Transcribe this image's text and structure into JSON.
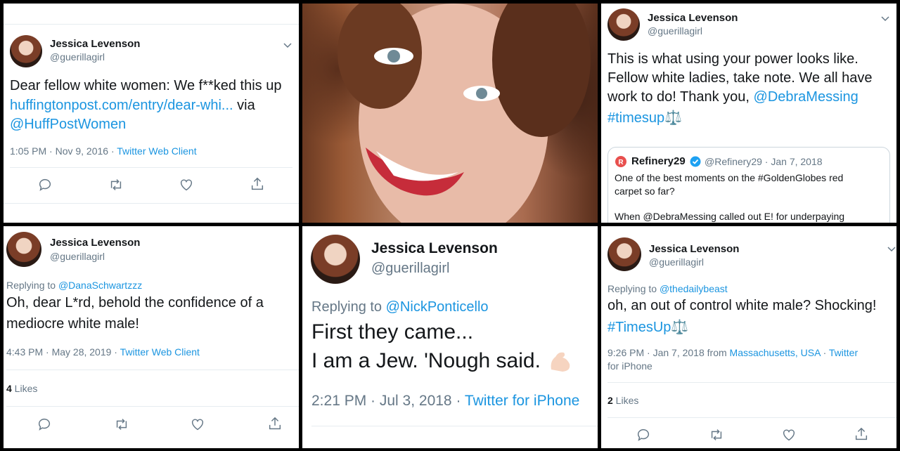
{
  "p1": {
    "name": "Jessica Levenson",
    "handle": "@guerillagirl",
    "line1": "Dear fellow white women: We f**ked this up",
    "link": "huffingtonpost.com/entry/dear-whi...",
    "via": "via",
    "mention": "@HuffPostWomen",
    "time": "1:05 PM · Nov 9, 2016 · ",
    "client": "Twitter Web Client"
  },
  "p3": {
    "name": "Jessica Levenson",
    "handle": "@guerillagirl",
    "line1": "This is what using your power looks like.",
    "line2": "Fellow white ladies, take note. We all have",
    "line3a": "work to do! Thank you, ",
    "mention": "@DebraMessing",
    "hashtag": "#timesup",
    "emoji": "⚖️",
    "quote": {
      "name": "Refinery29",
      "meta": "@Refinery29 · Jan 7, 2018",
      "line1": "One of the best moments on the #GoldenGlobes red",
      "line2": "carpet so far?",
      "line3": "When @DebraMessing called out E! for underpaying"
    }
  },
  "p4": {
    "name": "Jessica Levenson",
    "handle": "@guerillagirl",
    "replying": "Replying to ",
    "reply_to": "@DanaSchwartzzz",
    "line1": "Oh, dear L*rd, behold the confidence of a",
    "line2": "mediocre white male!",
    "time": "4:43 PM · May 28, 2019 · ",
    "client": "Twitter Web Client",
    "likes_count": "4",
    "likes_label": " Likes"
  },
  "p5": {
    "name": "Jessica Levenson",
    "handle": "@guerillagirl",
    "replying": "Replying to ",
    "reply_to": "@NickPonticello",
    "line1": "First they came...",
    "line2": "I am a Jew. 'Nough said.",
    "time": "2:21 PM · Jul 3, 2018 · ",
    "client": "Twitter for iPhone"
  },
  "p6": {
    "name": "Jessica Levenson",
    "handle": "@guerillagirl",
    "replying": "Replying to ",
    "reply_to": "@thedailybeast",
    "line1": "oh, an out of control white male?  Shocking!",
    "hashtag": "#TimesUp",
    "emoji": "⚖️",
    "time": "9:26 PM · Jan 7, 2018 from ",
    "location": "Massachusetts, USA",
    "sep": " · ",
    "client_a": "Twitter",
    "client_b": "for iPhone",
    "likes_count": "2",
    "likes_label": " Likes"
  },
  "colors": {
    "link": "#1b95e0",
    "muted": "#657786",
    "text": "#14171a",
    "divider": "#e6ecf0"
  }
}
